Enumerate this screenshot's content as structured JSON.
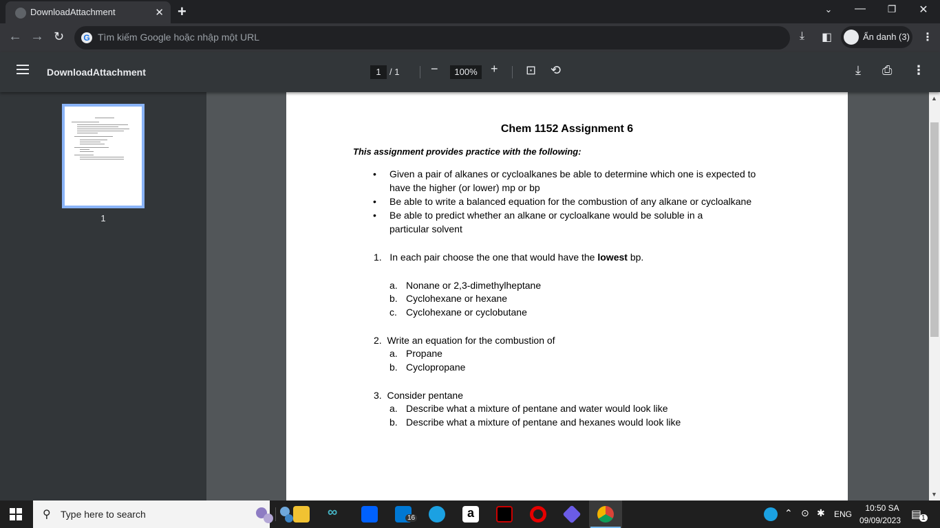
{
  "browser": {
    "tab_title": "DownloadAttachment",
    "tab_close": "✕",
    "new_tab": "+",
    "omnibox_placeholder": "Tìm kiếm Google hoặc nhập một URL",
    "incognito_label": "Ẩn danh (3)"
  },
  "pdf_toolbar": {
    "title": "DownloadAttachment",
    "current_page": "1",
    "total_pages": "/ 1",
    "zoom": "100%"
  },
  "sidebar": {
    "thumbnail_label": "1"
  },
  "document": {
    "title": "Chem 1152 Assignment 6",
    "intro": "This assignment provides practice with the following:",
    "bullets": [
      "Given a pair of alkanes or cycloalkanes be able to determine which one is expected to have the higher (or lower) mp or bp",
      "Be able to write a balanced equation for the combustion of any alkane or cycloalkane",
      "Be able to predict whether an alkane or cycloalkane would be soluble in a particular solvent"
    ],
    "q1": {
      "number": "1.",
      "text_before": "In each pair choose the one that would have the ",
      "bold": "lowest",
      "text_after": " bp.",
      "items": [
        {
          "letter": "a.",
          "text": "Nonane or 2,3-dimethylheptane"
        },
        {
          "letter": "b.",
          "text": "Cyclohexane or hexane"
        },
        {
          "letter": "c.",
          "text": "Cyclohexane or cyclobutane"
        }
      ]
    },
    "q2": {
      "number": "2.",
      "text": "Write an equation for the combustion of",
      "items": [
        {
          "letter": "a.",
          "text": "Propane"
        },
        {
          "letter": "b.",
          "text": "Cyclopropane"
        }
      ]
    },
    "q3": {
      "number": "3.",
      "text": "Consider pentane",
      "items": [
        {
          "letter": "a.",
          "text": "Describe what a mixture of pentane and water would look like"
        },
        {
          "letter": "b.",
          "text": "Describe what a mixture of pentane and hexanes would look like"
        }
      ]
    }
  },
  "taskbar": {
    "search_placeholder": "Type here to search",
    "mail_badge": "16",
    "language": "ENG",
    "time": "10:50 SA",
    "date": "09/09/2023",
    "notification_count": "1"
  }
}
